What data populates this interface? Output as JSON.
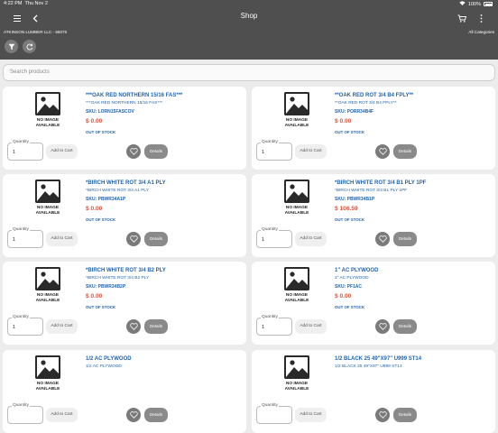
{
  "status_bar": {
    "time": "4:22 PM",
    "date": "Thu Nov 2",
    "battery": "100%"
  },
  "header": {
    "title": "Shop",
    "account": "ATKINSON LUMBER LLC - 65070",
    "categories_link": "All Categories"
  },
  "search": {
    "placeholder": "Search products"
  },
  "common": {
    "no_image_line1": "NO IMAGE",
    "no_image_line2": "AVAILABLE",
    "quantity_label": "Quantity",
    "add_to_cart": "Add to Cart",
    "details": "Details"
  },
  "products": [
    {
      "name": "***OAK RED NORTHERN 15/16 FAS***",
      "desc": "***OAK RED NORTHERN 15/16 FAS***",
      "sku": "SKU: LORN15FASCOV",
      "price": "$ 0.00",
      "stock": "OUT OF STOCK",
      "qty": "1"
    },
    {
      "name": "**OAK RED ROT 3/4 B4 FPLY**",
      "desc": "**OAK RED ROT 3/4 B4 FPLY**",
      "sku": "SKU: PORR34B4F",
      "price": "$ 0.00",
      "stock": "OUT OF STOCK",
      "qty": "1"
    },
    {
      "name": "*BIRCH WHITE ROT 3/4 A1 PLY",
      "desc": "*BIRCH WHITE ROT 3/4 A1 PLY",
      "sku": "SKU: PBWR34A1P",
      "price": "$ 0.00",
      "stock": "OUT OF STOCK",
      "qty": "1"
    },
    {
      "name": "*BIRCH WHITE ROT 3/4 B1 PLY 1PF",
      "desc": "*BIRCH WHITE ROT 3/4 B1 PLY 1PF",
      "sku": "SKU: PBWR34B1P",
      "price": "$ 106.59",
      "stock": "OUT OF STOCK",
      "qty": "1"
    },
    {
      "name": "*BIRCH WHITE ROT 3/4 B2 PLY",
      "desc": "*BIRCH WHITE ROT 3/4 B2 PLY",
      "sku": "SKU: PBWR34B2P",
      "price": "$ 0.00",
      "stock": "OUT OF STOCK",
      "qty": "1"
    },
    {
      "name": "1\" AC PLYWOOD",
      "desc": "1\" AC PLYWOOD",
      "sku": "SKU: PF1AC",
      "price": "$ 0.00",
      "stock": "OUT OF STOCK",
      "qty": "1"
    },
    {
      "name": "1/2 AC PLYWOOD",
      "desc": "1/2 AC PLYWOOD",
      "sku": "",
      "price": "",
      "stock": "",
      "qty": ""
    },
    {
      "name": "1/2 BLACK 25 49\"X97\" U999 ST14",
      "desc": "1/2 BLACK 25 49\"X97\" U999 ST14",
      "sku": "",
      "price": "",
      "stock": "",
      "qty": ""
    }
  ],
  "colors": {
    "header_bg": "#4f4f4f",
    "link_blue": "#1f63b0",
    "price_red": "#e0513a"
  }
}
